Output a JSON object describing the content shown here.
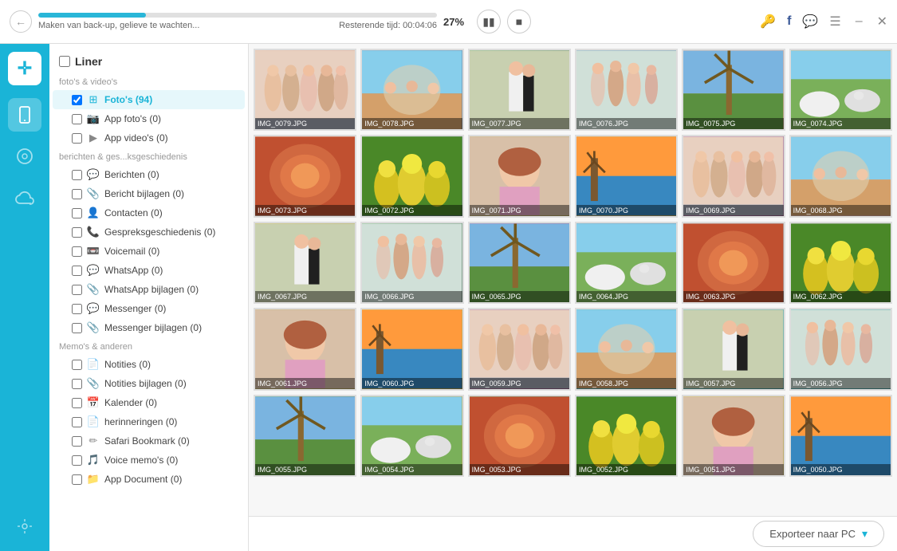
{
  "titleBar": {
    "progressPercent": "27%",
    "progressValue": 27,
    "statusText": "Maken van back-up, gelieve te wachten...",
    "remainingLabel": "Resterende tijd:",
    "remainingTime": "00:04:06"
  },
  "controls": {
    "pauseLabel": "⏸",
    "stopLabel": "⏹"
  },
  "windowControls": {
    "minimize": "–",
    "close": "✕"
  },
  "sidebar": {
    "navItems": [
      {
        "id": "device",
        "icon": "📱",
        "active": true
      },
      {
        "id": "music",
        "icon": "♪",
        "active": false
      },
      {
        "id": "cloud",
        "icon": "☁",
        "active": false
      },
      {
        "id": "tools",
        "icon": "🔧",
        "active": false
      }
    ]
  },
  "leftPanel": {
    "headerCheckbox": false,
    "headerTitle": "Liner",
    "sections": [
      {
        "label": "foto's & video's",
        "items": [
          {
            "id": "fotos",
            "icon": "🖼",
            "label": "Foto's (94)",
            "active": true,
            "checked": true
          },
          {
            "id": "app-fotos",
            "icon": "📷",
            "label": "App foto's (0)",
            "active": false,
            "checked": false
          },
          {
            "id": "app-videos",
            "icon": "▶",
            "label": "App video's (0)",
            "active": false,
            "checked": false
          }
        ]
      },
      {
        "label": "berichten & ges...ksgeschiedenis",
        "items": [
          {
            "id": "berichten",
            "icon": "💬",
            "label": "Berichten (0)",
            "active": false,
            "checked": false
          },
          {
            "id": "bericht-bijlagen",
            "icon": "📎",
            "label": "Bericht bijlagen (0)",
            "active": false,
            "checked": false
          },
          {
            "id": "contacten",
            "icon": "👤",
            "label": "Contacten (0)",
            "active": false,
            "checked": false
          },
          {
            "id": "gespreksgeschiedenis",
            "icon": "📞",
            "label": "Gespreksgeschiedenis (0)",
            "active": false,
            "checked": false
          },
          {
            "id": "voicemail",
            "icon": "📼",
            "label": "Voicemail (0)",
            "active": false,
            "checked": false
          },
          {
            "id": "whatsapp",
            "icon": "💬",
            "label": "WhatsApp (0)",
            "active": false,
            "checked": false
          },
          {
            "id": "whatsapp-bijlagen",
            "icon": "📎",
            "label": "WhatsApp bijlagen (0)",
            "active": false,
            "checked": false
          },
          {
            "id": "messenger",
            "icon": "💬",
            "label": "Messenger (0)",
            "active": false,
            "checked": false
          },
          {
            "id": "messenger-bijlagen",
            "icon": "📎",
            "label": "Messenger bijlagen (0)",
            "active": false,
            "checked": false
          }
        ]
      },
      {
        "label": "Memo's & anderen",
        "items": [
          {
            "id": "notities",
            "icon": "📄",
            "label": "Notities (0)",
            "active": false,
            "checked": false
          },
          {
            "id": "notities-bijlagen",
            "icon": "📎",
            "label": "Notities bijlagen (0)",
            "active": false,
            "checked": false
          },
          {
            "id": "kalender",
            "icon": "📅",
            "label": "Kalender (0)",
            "active": false,
            "checked": false
          },
          {
            "id": "herinneringen",
            "icon": "📄",
            "label": "herinneringen (0)",
            "active": false,
            "checked": false
          },
          {
            "id": "safari",
            "icon": "✏",
            "label": "Safari Bookmark (0)",
            "active": false,
            "checked": false
          },
          {
            "id": "voice-memos",
            "icon": "🎵",
            "label": "Voice memo's (0)",
            "active": false,
            "checked": false
          },
          {
            "id": "app-document",
            "icon": "📁",
            "label": "App Document (0)",
            "active": false,
            "checked": false
          }
        ]
      }
    ]
  },
  "photoGrid": {
    "photos": [
      {
        "id": "IMG_0079",
        "label": "IMG_0079.JPG",
        "colorClass": "c1"
      },
      {
        "id": "IMG_0078",
        "label": "IMG_0078.JPG",
        "colorClass": "c2"
      },
      {
        "id": "IMG_0077",
        "label": "IMG_0077.JPG",
        "colorClass": "c3"
      },
      {
        "id": "IMG_0076",
        "label": "IMG_0076.JPG",
        "colorClass": "c2"
      },
      {
        "id": "IMG_0075",
        "label": "IMG_0075.JPG",
        "colorClass": "c1"
      },
      {
        "id": "IMG_0074",
        "label": "IMG_0074.JPG",
        "colorClass": "c4"
      },
      {
        "id": "IMG_0073",
        "label": "IMG_0073.JPG",
        "colorClass": "c1"
      },
      {
        "id": "IMG_0072",
        "label": "IMG_0072.JPG",
        "colorClass": "c3"
      },
      {
        "id": "IMG_0071",
        "label": "IMG_0071.JPG",
        "colorClass": "c4"
      },
      {
        "id": "IMG_0070",
        "label": "IMG_0070.JPG",
        "colorClass": "c4"
      },
      {
        "id": "IMG_0069",
        "label": "IMG_0069.JPG",
        "colorClass": "c5"
      },
      {
        "id": "IMG_0068",
        "label": "IMG_0068.JPG",
        "colorClass": "c1"
      },
      {
        "id": "IMG_0067",
        "label": "IMG_0067.JPG",
        "colorClass": "c7"
      },
      {
        "id": "IMG_0066",
        "label": "IMG_0066.JPG",
        "colorClass": "c3"
      },
      {
        "id": "IMG_0065",
        "label": "IMG_0065.JPG",
        "colorClass": "c5"
      },
      {
        "id": "IMG_0064",
        "label": "IMG_0064.JPG",
        "colorClass": "c2"
      },
      {
        "id": "IMG_0063",
        "label": "IMG_0063.JPG",
        "colorClass": "c6"
      },
      {
        "id": "IMG_0062",
        "label": "IMG_0062.JPG",
        "colorClass": "c6"
      },
      {
        "id": "IMG_0061",
        "label": "IMG_0061.JPG",
        "colorClass": "c4"
      },
      {
        "id": "IMG_0060",
        "label": "IMG_0060.JPG",
        "colorClass": "c7"
      },
      {
        "id": "IMG_0059",
        "label": "IMG_0059.JPG",
        "colorClass": "c5"
      },
      {
        "id": "IMG_0058",
        "label": "IMG_0058.JPG",
        "colorClass": "c8"
      },
      {
        "id": "IMG_0057",
        "label": "IMG_0057.JPG",
        "colorClass": "c8"
      },
      {
        "id": "IMG_0056",
        "label": "IMG_0056.JPG",
        "colorClass": "c8"
      },
      {
        "id": "IMG_0055",
        "label": "IMG_0055.JPG",
        "colorClass": "c3"
      },
      {
        "id": "IMG_0054",
        "label": "IMG_0054.JPG",
        "colorClass": "c7"
      },
      {
        "id": "IMG_0053",
        "label": "IMG_0053.JPG",
        "colorClass": "c3"
      },
      {
        "id": "IMG_0052",
        "label": "IMG_0052.JPG",
        "colorClass": "c2"
      },
      {
        "id": "IMG_0051",
        "label": "IMG_0051.JPG",
        "colorClass": "c7"
      },
      {
        "id": "IMG_0050",
        "label": "IMG_0050.JPG",
        "colorClass": "c6"
      }
    ]
  },
  "bottomBar": {
    "exportLabel": "Exporteer naar PC",
    "exportArrow": "▾"
  }
}
